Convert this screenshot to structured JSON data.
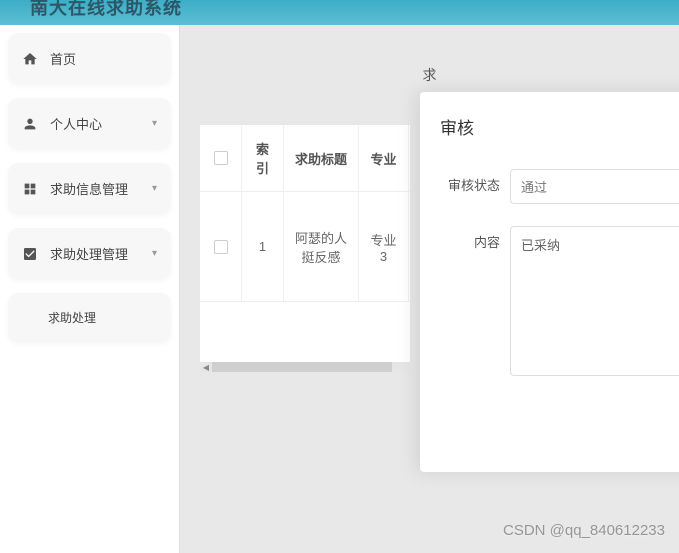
{
  "header": {
    "title": "南大在线求助系统"
  },
  "sidebar": {
    "items": [
      {
        "icon": "home",
        "label": "首页",
        "expandable": false
      },
      {
        "icon": "user",
        "label": "个人中心",
        "expandable": true
      },
      {
        "icon": "grid",
        "label": "求助信息管理",
        "expandable": true
      },
      {
        "icon": "check",
        "label": "求助处理管理",
        "expandable": true
      },
      {
        "icon": "",
        "label": "求助处理",
        "expandable": false,
        "child": true
      }
    ]
  },
  "content": {
    "title_fragment": "求"
  },
  "table": {
    "headers": {
      "index": "索引",
      "title": "求助标题",
      "major": "专业"
    },
    "rows": [
      {
        "index": "1",
        "title": "阿瑟的人挺反感",
        "major": "专业3"
      }
    ]
  },
  "modal": {
    "title": "审核",
    "status_label": "审核状态",
    "status_value": "通过",
    "content_label": "内容",
    "content_value": "已采纳"
  },
  "watermark": "CSDN @qq_840612233"
}
